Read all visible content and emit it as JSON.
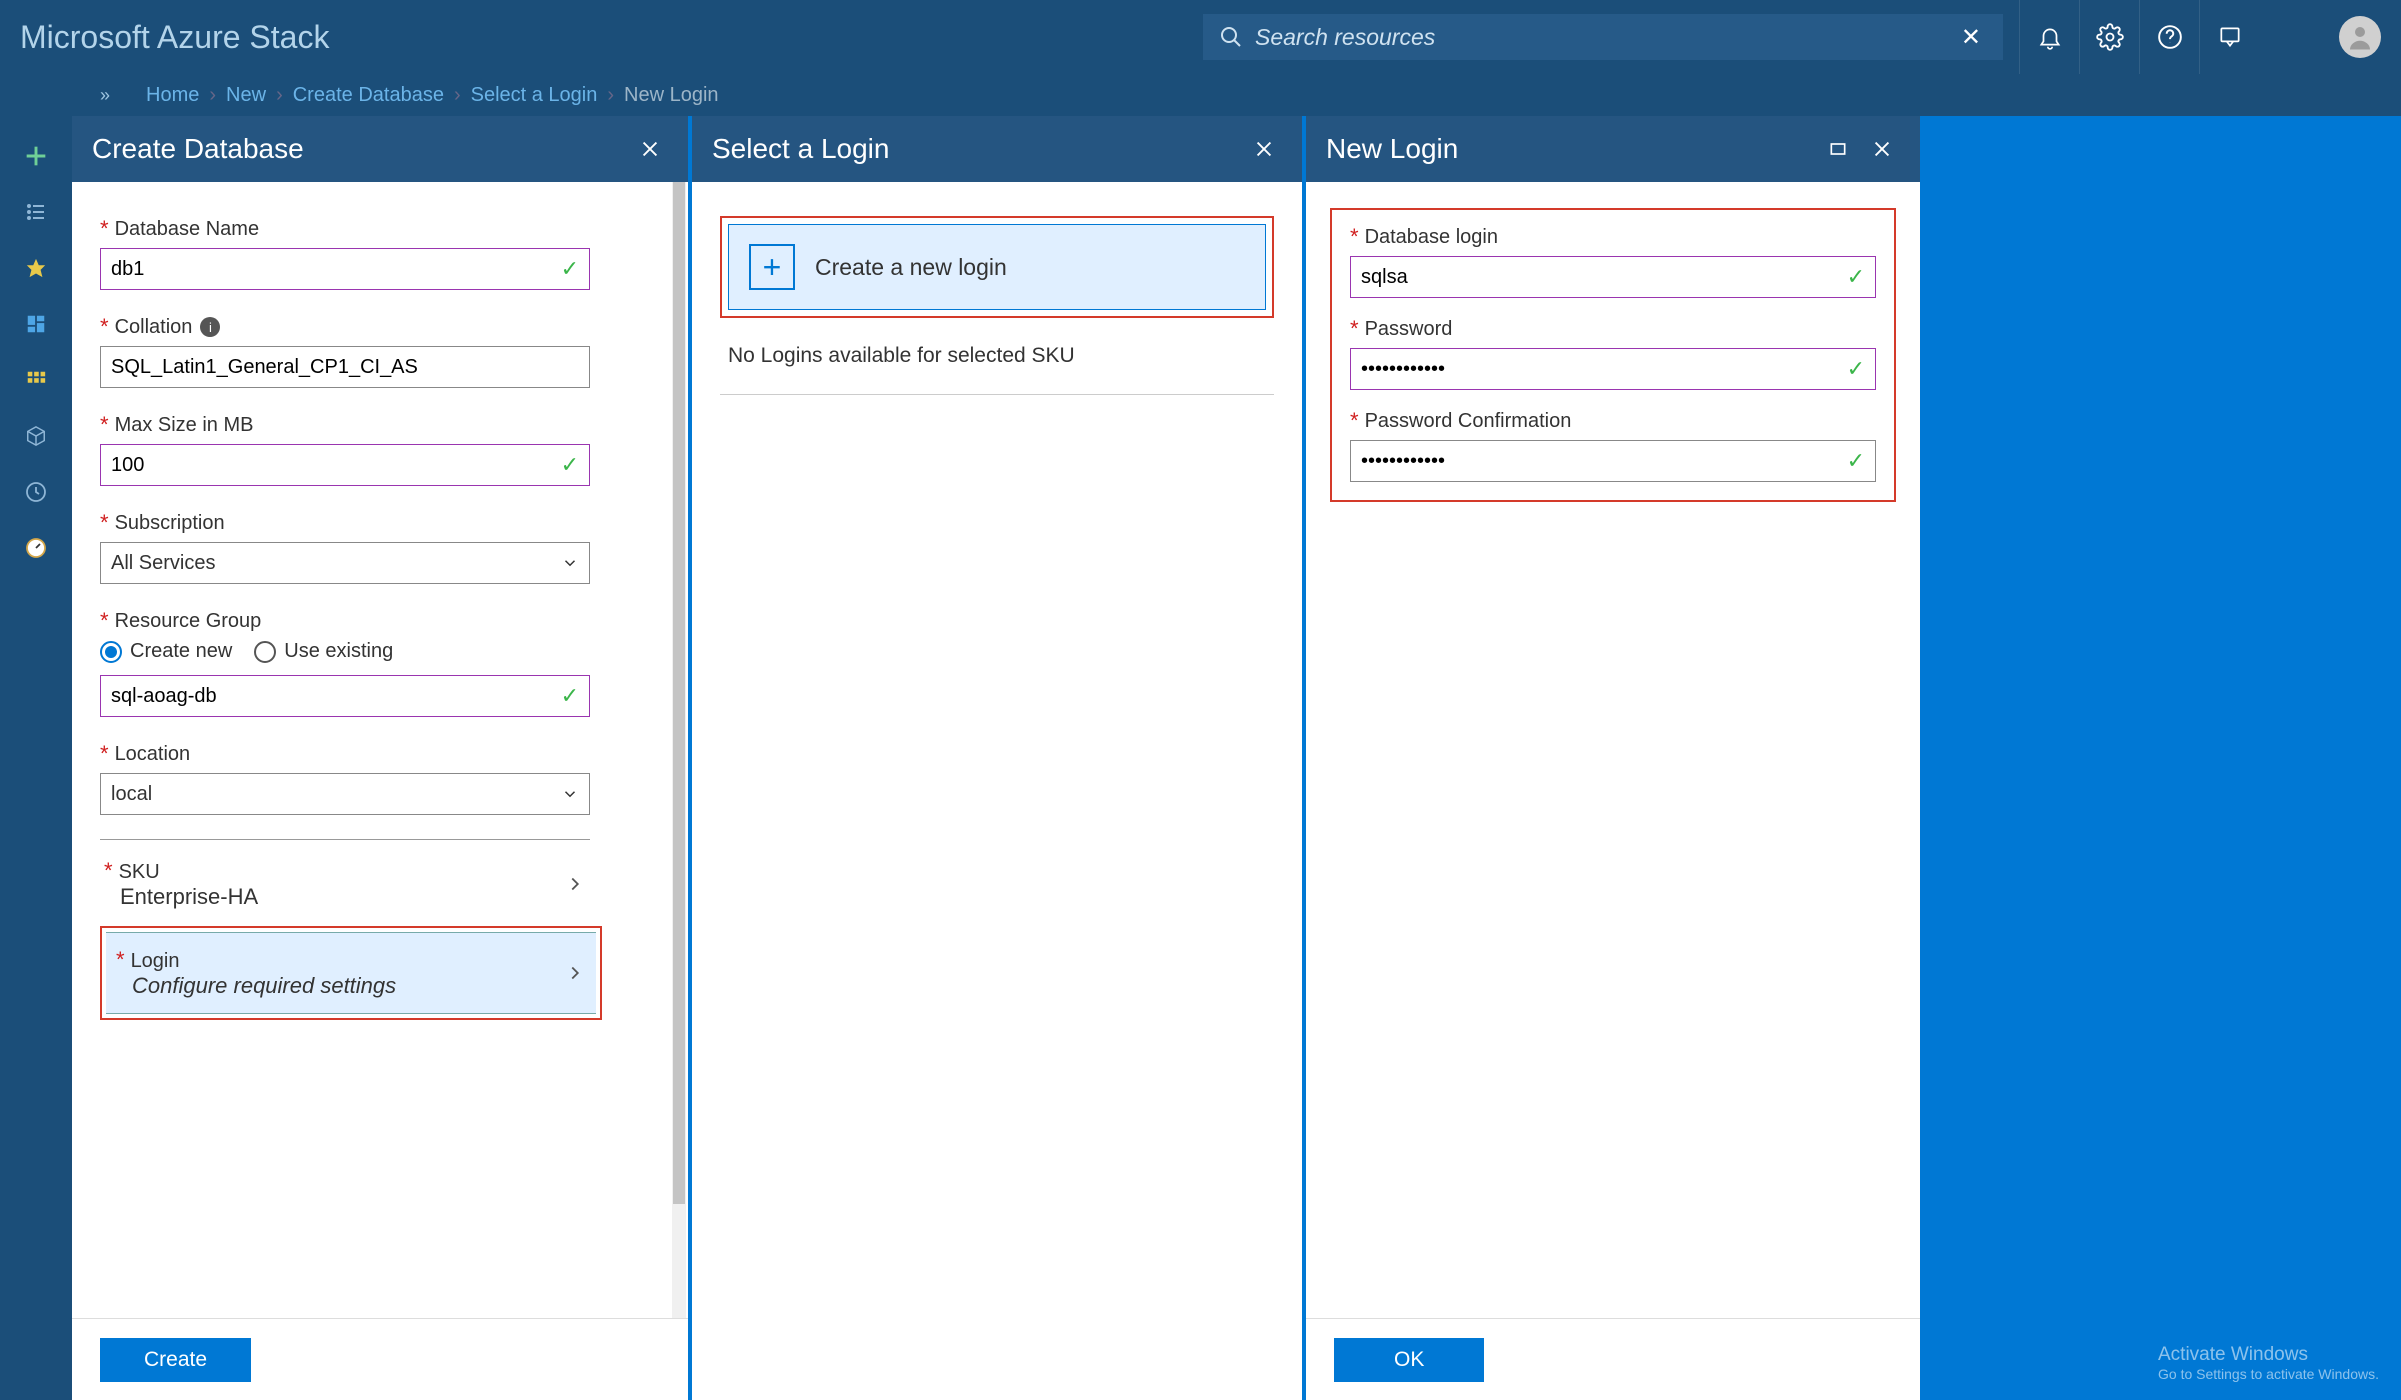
{
  "topbar": {
    "brand": "Microsoft Azure Stack",
    "search_placeholder": "Search resources"
  },
  "breadcrumbs": {
    "items": [
      "Home",
      "New",
      "Create Database",
      "Select a Login"
    ],
    "current": "New Login"
  },
  "blade1": {
    "title": "Create Database",
    "db_name_label": "Database Name",
    "db_name_value": "db1",
    "collation_label": "Collation",
    "collation_value": "SQL_Latin1_General_CP1_CI_AS",
    "max_size_label": "Max Size in MB",
    "max_size_value": "100",
    "subscription_label": "Subscription",
    "subscription_value": "All Services",
    "rg_label": "Resource Group",
    "rg_create": "Create new",
    "rg_use": "Use existing",
    "rg_value": "sql-aoag-db",
    "location_label": "Location",
    "location_value": "local",
    "sku_label": "SKU",
    "sku_value": "Enterprise-HA",
    "login_label": "Login",
    "login_sub": "Configure required settings",
    "create_btn": "Create"
  },
  "blade2": {
    "title": "Select a Login",
    "create_login": "Create a new login",
    "no_logins": "No Logins available for selected SKU"
  },
  "blade3": {
    "title": "New Login",
    "db_login_label": "Database login",
    "db_login_value": "sqlsa",
    "pw_label": "Password",
    "pw_value": "••••••••••••",
    "pwc_label": "Password Confirmation",
    "pwc_value": "••••••••••••",
    "ok_btn": "OK"
  },
  "watermark": {
    "line1": "Activate Windows",
    "line2": "Go to Settings to activate Windows."
  }
}
